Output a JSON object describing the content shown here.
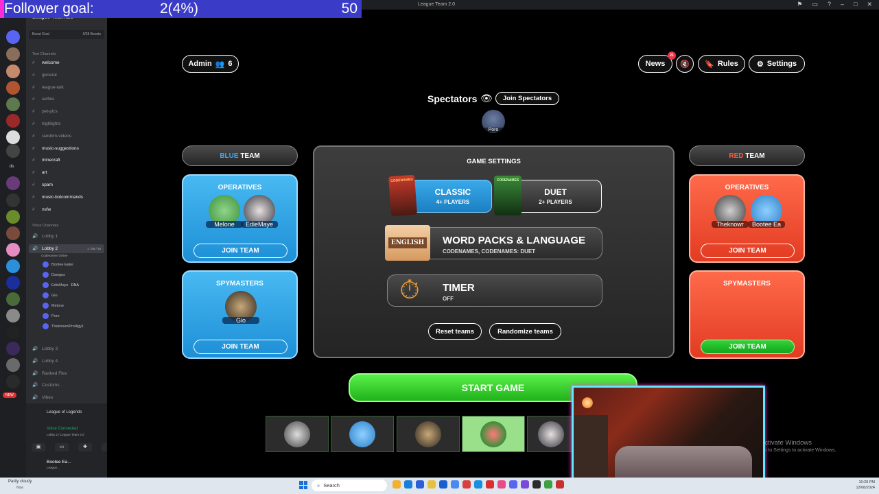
{
  "overlay": {
    "label": "Follower goal:",
    "progress": "2(4%)",
    "target": "50"
  },
  "window": {
    "title": "League Team 2.0"
  },
  "discord": {
    "server_name": "League Team 2.0",
    "boost_label": "Boost Goal",
    "boost_count": "0/28 Boosts",
    "text_channels_label": "Text Channels",
    "text_channels": [
      {
        "name": "welcome",
        "bold": true
      },
      {
        "name": "general",
        "bold": false
      },
      {
        "name": "league-talk",
        "bold": false
      },
      {
        "name": "selfies",
        "bold": false
      },
      {
        "name": "pet-pics",
        "bold": false
      },
      {
        "name": "highlights",
        "bold": false
      },
      {
        "name": "random-videos",
        "bold": false
      },
      {
        "name": "music-suggestions",
        "bold": true
      },
      {
        "name": "minecraft",
        "bold": true
      },
      {
        "name": "art",
        "bold": true
      },
      {
        "name": "spam",
        "bold": true
      },
      {
        "name": "music-botcommands",
        "bold": true
      },
      {
        "name": "nsfw",
        "bold": true
      }
    ],
    "voice_channels_label": "Voice Channels",
    "lobby1": "Lobby 1",
    "lobby2": "Lobby 2",
    "lobby2_count": "1 / 59 / 19",
    "lobby2_status": "Codenames Online",
    "voice_users": [
      "Bootee Eater",
      "Dawgus",
      "EdieMaye",
      "Gio",
      "Melone",
      "Poro",
      "TheknownProdigy1"
    ],
    "ediemaye_tag": "DNA",
    "other_voice": [
      "Lobby 3",
      "Lobby 4",
      "Ranked Flex",
      "Customs",
      "Vibes",
      "Minecraft"
    ],
    "new_badge": "NEW",
    "ds_label": "ds",
    "activity": "League of Legends",
    "voice_connected": "Voice Connected",
    "voice_location": "Lobby 2 / League Team 2.0",
    "user_name": "Bootee Ea...",
    "user_status": "League..."
  },
  "game": {
    "admin_label": "Admin",
    "admin_count": "6",
    "news_label": "News",
    "news_badge": "21",
    "rules_label": "Rules",
    "settings_label": "Settings",
    "spectators_label": "Spectators",
    "join_spectators": "Join Spectators",
    "spectator_name": "Poro",
    "blue_team": {
      "color_word": "BLUE",
      "word": "TEAM",
      "operatives_label": "OPERATIVES",
      "operatives": [
        "Melone",
        "EdieMaye"
      ],
      "spymasters_label": "SPYMASTERS",
      "spymasters": [
        "Gio"
      ],
      "join_label": "JOIN TEAM"
    },
    "red_team": {
      "color_word": "RED",
      "word": "TEAM",
      "operatives_label": "OPERATIVES",
      "operatives": [
        "Theknowr",
        "Bootee Ea"
      ],
      "spymasters_label": "SPYMASTERS",
      "spymasters": [],
      "join_label": "JOIN TEAM"
    },
    "settings_title": "GAME SETTINGS",
    "mode_classic": {
      "title": "CLASSIC",
      "sub": "4+ PLAYERS"
    },
    "mode_duet": {
      "title": "DUET",
      "sub": "2+ PLAYERS"
    },
    "pack_art_1": "CODENAMES",
    "pack_art_2": "CODENAMES",
    "word_packs": {
      "title": "WORD PACKS & LANGUAGE",
      "sub": "CODENAMES, CODENAMES: DUET",
      "language": "ENGLISH"
    },
    "timer": {
      "title": "TIMER",
      "sub": "OFF"
    },
    "reset_teams": "Reset teams",
    "randomize_teams": "Randomize teams",
    "start_game": "START GAME"
  },
  "windows_notice": {
    "line1": "Activate Windows",
    "line2": "Go to Settings to activate Windows."
  },
  "taskbar": {
    "weather": "Partly cloudy",
    "weather2": "Now",
    "search": "Search",
    "time": "10:29 PM",
    "date": "12/08/2024"
  },
  "colors": {
    "blue": "#1d8fd6",
    "red": "#e23b22",
    "green": "#1fb21a",
    "goal_bar": "#3a3cc8",
    "goal_accent": "#ff2bd6"
  }
}
